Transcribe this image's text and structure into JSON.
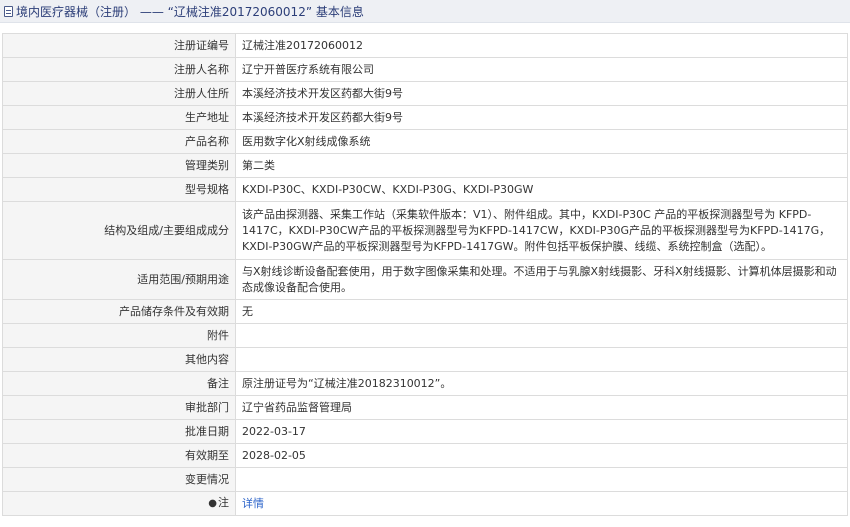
{
  "header": {
    "title": "境内医疗器械（注册） —— “辽械注准20172060012” 基本信息"
  },
  "rows": [
    {
      "label": "注册证编号",
      "value": "辽械注准20172060012"
    },
    {
      "label": "注册人名称",
      "value": "辽宁开普医疗系统有限公司"
    },
    {
      "label": "注册人住所",
      "value": "本溪经济技术开发区药都大街9号"
    },
    {
      "label": "生产地址",
      "value": "本溪经济技术开发区药都大街9号"
    },
    {
      "label": "产品名称",
      "value": "医用数字化X射线成像系统"
    },
    {
      "label": "管理类别",
      "value": "第二类"
    },
    {
      "label": "型号规格",
      "value": "KXDI-P30C、KXDI-P30CW、KXDI-P30G、KXDI-P30GW"
    },
    {
      "label": "结构及组成/主要组成成分",
      "value": "该产品由探测器、采集工作站（采集软件版本：V1）、附件组成。其中，KXDI-P30C 产品的平板探测器型号为 KFPD-1417C，KXDI-P30CW产品的平板探测器型号为KFPD-1417CW，KXDI-P30G产品的平板探测器型号为KFPD-1417G，KXDI-P30GW产品的平板探测器型号为KFPD-1417GW。附件包括平板保护膜、线缆、系统控制盒（选配）。"
    },
    {
      "label": "适用范围/预期用途",
      "value": "与X射线诊断设备配套使用，用于数字图像采集和处理。不适用于与乳腺X射线摄影、牙科X射线摄影、计算机体层摄影和动态成像设备配合使用。"
    },
    {
      "label": "产品储存条件及有效期",
      "value": "无"
    },
    {
      "label": "附件",
      "value": ""
    },
    {
      "label": "其他内容",
      "value": ""
    },
    {
      "label": "备注",
      "value": "原注册证号为“辽械注准20182310012”。"
    },
    {
      "label": "审批部门",
      "value": "辽宁省药品监督管理局"
    },
    {
      "label": "批准日期",
      "value": "2022-03-17"
    },
    {
      "label": "有效期至",
      "value": "2028-02-05"
    },
    {
      "label": "变更情况",
      "value": ""
    }
  ],
  "note_row": {
    "label": "注",
    "link_text": "详情",
    "icon": "pin-icon"
  }
}
